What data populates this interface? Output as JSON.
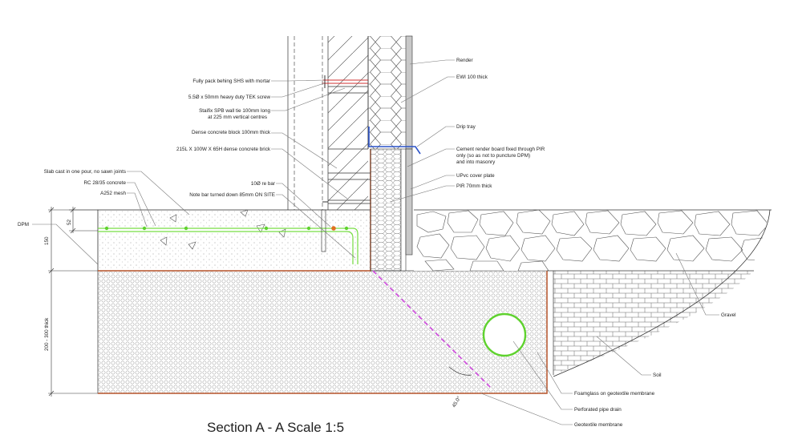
{
  "title": "Section A - A Scale 1:5",
  "labels": {
    "fully_pack": "Fully pack behing SHS with mortar",
    "tek_screw": "5.5Ø x 50mm heavy duty TEK screw",
    "wall_tie_1": "Staifix SPB wall tie 100mm long",
    "wall_tie_2": "at 225 mm vertical centres",
    "dense_block": "Dense concrete block 100mm thick",
    "dense_brick": "215L X 100W X 65H dense concrete brick",
    "slab_cast": "Slab cast in one pour, no sawn joints",
    "rc_concrete": "RC 28/35 concrete",
    "mesh": "A252  mesh",
    "re_bar": "10Ø re bar",
    "note_bar": "Note bar turned down 85mm ON SITE",
    "dpm": "DPM",
    "render": "Render",
    "ewi": "EWI 100 thick",
    "drip_tray": "Drip tray",
    "cement_board_1": "Cement render board fixed through PIR",
    "cement_board_2": "only (so as not to puncture DPM)",
    "cement_board_3": "and into masonry",
    "upvc": "UPvc cover plate",
    "pir": "PIR 70mm thick",
    "gravel": "Gravel",
    "soil": "Soil",
    "foamglass": "Foamglass on geotextile membrane",
    "pipe_drain": "Perforated pipe drain",
    "geotextile": "Geotextile membrane"
  },
  "dimensions": {
    "cover": "52",
    "slab": "150",
    "subbase": "200 - 300 thick",
    "angle": "45.0°"
  },
  "colors": {
    "line": "#333333",
    "dpm": "#b5532a",
    "rebar": "#77dd44",
    "drip_tray": "#2a52c8",
    "drain": "#5fd22e",
    "diagonal": "#d04adf",
    "rebar_dot": "#e07020"
  }
}
